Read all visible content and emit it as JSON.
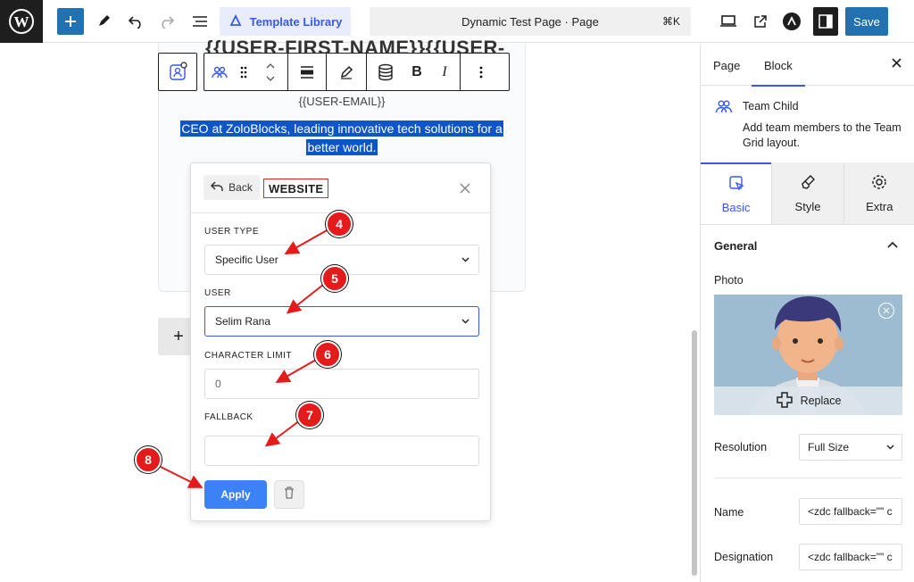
{
  "topbar": {
    "template_library_label": "Template Library",
    "document_title": "Dynamic Test Page · Page",
    "shortcut": "⌘K",
    "save_label": "Save"
  },
  "canvas": {
    "name_line": "{{USER-FIRST-NAME}}{{USER-",
    "email": "{{USER-EMAIL}}",
    "bio_line1": "CEO at ZoloBlocks, leading innovative tech solutions for a",
    "bio_line2": "better world.",
    "add_block_label": "+"
  },
  "block_toolbar": {
    "bold_label": "B",
    "italic_label": "I"
  },
  "popover": {
    "back_label": "Back",
    "title": "WEBSITE",
    "fields": {
      "user_type_label": "USER TYPE",
      "user_type_value": "Specific User",
      "user_label": "USER",
      "user_value": "Selim Rana",
      "char_limit_label": "CHARACTER LIMIT",
      "char_limit_value": "0",
      "fallback_label": "FALLBACK",
      "fallback_value": ""
    },
    "apply_label": "Apply"
  },
  "annotations": [
    "4",
    "5",
    "6",
    "7",
    "8"
  ],
  "sidebar": {
    "tabs": [
      "Page",
      "Block"
    ],
    "active_tab": "Block",
    "block_title": "Team Child",
    "block_desc": "Add team members to the Team Grid layout.",
    "subtabs": [
      "Basic",
      "Style",
      "Extra"
    ],
    "section_title": "General",
    "photo_label": "Photo",
    "replace_label": "Replace",
    "resolution_label": "Resolution",
    "resolution_value": "Full Size",
    "name_label": "Name",
    "name_value": "<zdc fallback=\"\" c",
    "designation_label": "Designation",
    "designation_value": "<zdc fallback=\"\" c"
  },
  "colors": {
    "accent": "#3858e9",
    "save": "#2271b1",
    "apply": "#3b82f6",
    "annotation": "#e51b1b",
    "selection": "#0e55c8"
  }
}
